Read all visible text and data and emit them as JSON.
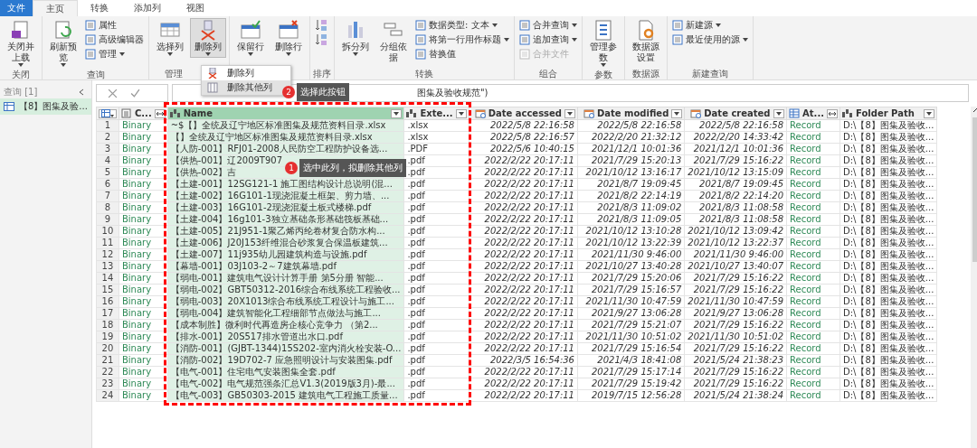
{
  "tabs": [
    {
      "label": "文件",
      "kind": "file",
      "selected": false
    },
    {
      "label": "主页",
      "kind": "tab",
      "selected": true
    },
    {
      "label": "转换",
      "kind": "tab",
      "selected": false
    },
    {
      "label": "添加列",
      "kind": "tab",
      "selected": false
    },
    {
      "label": "视图",
      "kind": "tab",
      "selected": false
    }
  ],
  "ribbon": [
    {
      "label": "关闭",
      "items": [
        {
          "kind": "large",
          "label": "关闭并上载",
          "dropdown": true,
          "pressed": false
        }
      ]
    },
    {
      "label": "查询",
      "items": [
        {
          "kind": "large",
          "label": "刷新预览",
          "dropdown": true,
          "pressed": false
        },
        {
          "kind": "stack",
          "buttons": [
            {
              "label": "属性",
              "dropdown": false,
              "disabled": false
            },
            {
              "label": "高级编辑器",
              "dropdown": false,
              "disabled": false
            },
            {
              "label": "管理",
              "dropdown": true,
              "disabled": false
            }
          ]
        }
      ]
    },
    {
      "label": "管理",
      "items": [
        {
          "kind": "large",
          "label": "选择列",
          "dropdown": true,
          "pressed": false
        },
        {
          "kind": "large",
          "label": "删除列",
          "dropdown": true,
          "pressed": true
        }
      ]
    },
    {
      "items": [
        {
          "kind": "large",
          "label": "保留行",
          "dropdown": true,
          "pressed": false
        },
        {
          "kind": "large",
          "label": "删除行",
          "dropdown": true,
          "pressed": false
        }
      ]
    },
    {
      "label": "排序",
      "items": [
        {
          "kind": "sort"
        }
      ]
    },
    {
      "label": "转换",
      "items": [
        {
          "kind": "large",
          "label": "拆分列",
          "dropdown": true,
          "pressed": false
        },
        {
          "kind": "large",
          "label": "分组依据",
          "dropdown": false,
          "pressed": false
        },
        {
          "kind": "stack",
          "buttons": [
            {
              "label": "数据类型: 文本",
              "dropdown": true,
              "disabled": false
            },
            {
              "label": "将第一行用作标题",
              "dropdown": true,
              "disabled": false
            },
            {
              "label": "替换值",
              "dropdown": false,
              "disabled": false
            }
          ]
        }
      ]
    },
    {
      "label": "组合",
      "items": [
        {
          "kind": "stack",
          "buttons": [
            {
              "label": "合并查询",
              "dropdown": true,
              "disabled": false
            },
            {
              "label": "追加查询",
              "dropdown": true,
              "disabled": false
            },
            {
              "label": "合并文件",
              "dropdown": false,
              "disabled": true
            }
          ]
        }
      ]
    },
    {
      "label": "参数",
      "items": [
        {
          "kind": "large",
          "label": "管理参数",
          "dropdown": true,
          "pressed": false
        }
      ]
    },
    {
      "label": "数据源",
      "items": [
        {
          "kind": "large",
          "label": "数据源设置",
          "dropdown": false,
          "pressed": false
        }
      ]
    },
    {
      "label": "新建查询",
      "items": [
        {
          "kind": "stack",
          "buttons": [
            {
              "label": "新建源",
              "dropdown": true,
              "disabled": false
            },
            {
              "label": "最近使用的源",
              "dropdown": true,
              "disabled": false
            }
          ]
        }
      ]
    }
  ],
  "menu": {
    "items": [
      {
        "label": "删除列",
        "selected": false
      },
      {
        "label": "删除其他列",
        "selected": true
      }
    ]
  },
  "callouts": [
    {
      "number": "2",
      "text": "选择此按钮"
    },
    {
      "number": "1",
      "text": "选中此列，拟删除其他列"
    }
  ],
  "highlight_frame": true,
  "queries_pane": {
    "title": "查询 [1]",
    "items": [
      {
        "label": "【8】图集及验...",
        "selected": true
      }
    ]
  },
  "formula_bar": {
    "formula": "图集及验收规范\")"
  },
  "table": {
    "columns": [
      {
        "label": "C...",
        "kind": "list",
        "selected": false
      },
      {
        "label": "Name",
        "kind": "text",
        "selected": true
      },
      {
        "label": "Exte...",
        "kind": "text",
        "selected": false
      },
      {
        "label": "Date accessed",
        "kind": "date",
        "selected": false
      },
      {
        "label": "Date modified",
        "kind": "date",
        "selected": false
      },
      {
        "label": "Date created",
        "kind": "date",
        "selected": false
      },
      {
        "label": "At...",
        "kind": "record",
        "selected": false
      },
      {
        "label": "Folder Path",
        "kind": "text",
        "selected": false
      }
    ],
    "rows": [
      {
        "number": "1",
        "cells": [
          "Binary",
          "~$【】全统及辽宁地区标准图集及规范资料目录.xlsx",
          ".xlsx",
          "2022/5/8 22:16:58",
          "2022/5/8 22:16:58",
          "2022/5/8 22:16:58",
          "Record",
          "D:\\【8】图集及验收..."
        ]
      },
      {
        "number": "2",
        "cells": [
          "Binary",
          "【】全统及辽宁地区标准图集及规范资料目录.xlsx",
          ".xlsx",
          "2022/5/8 22:16:57",
          "2022/2/20 21:32:12",
          "2022/2/20 14:33:42",
          "Record",
          "D:\\【8】图集及验收..."
        ]
      },
      {
        "number": "3",
        "cells": [
          "Binary",
          "【人防-001】RFJ01-2008人民防空工程防护设备选...",
          ".PDF",
          "2022/5/6 10:40:15",
          "2021/12/1 10:01:36",
          "2021/12/1 10:01:36",
          "Record",
          "D:\\【8】图集及验收..."
        ]
      },
      {
        "number": "4",
        "cells": [
          "Binary",
          "【供热-001】辽2009T907",
          ".pdf",
          "2022/2/22 20:17:11",
          "2021/7/29 15:20:13",
          "2021/7/29 15:16:22",
          "Record",
          "D:\\【8】图集及验收..."
        ]
      },
      {
        "number": "5",
        "cells": [
          "Binary",
          "【供热-002】吉",
          ".pdf",
          "2022/2/22 20:17:11",
          "2021/10/12 13:16:17",
          "2021/10/12 13:15:09",
          "Record",
          "D:\\【8】图集及验收..."
        ]
      },
      {
        "number": "6",
        "cells": [
          "Binary",
          "【土建-001】12SG121-1 施工图结构设计总说明(混...",
          ".pdf",
          "2022/2/22 20:17:11",
          "2021/8/7 19:09:45",
          "2021/8/7 19:09:45",
          "Record",
          "D:\\【8】图集及验收..."
        ]
      },
      {
        "number": "7",
        "cells": [
          "Binary",
          "【土建-002】16G101-1现浇混凝土框架、剪力墙、...",
          ".pdf",
          "2022/2/22 20:17:11",
          "2021/8/2 22:14:19",
          "2021/8/2 22:14:20",
          "Record",
          "D:\\【8】图集及验收..."
        ]
      },
      {
        "number": "8",
        "cells": [
          "Binary",
          "【土建-003】16G101-2现浇混凝土板式楼梯.pdf",
          ".pdf",
          "2022/2/22 20:17:11",
          "2021/8/3 11:09:02",
          "2021/8/3 11:08:58",
          "Record",
          "D:\\【8】图集及验收..."
        ]
      },
      {
        "number": "9",
        "cells": [
          "Binary",
          "【土建-004】16g101-3独立基础条形基础筏板基础...",
          ".pdf",
          "2022/2/22 20:17:11",
          "2021/8/3 11:09:05",
          "2021/8/3 11:08:58",
          "Record",
          "D:\\【8】图集及验收..."
        ]
      },
      {
        "number": "10",
        "cells": [
          "Binary",
          "【土建-005】21J951-1聚乙烯丙纶卷材复合防水构...",
          ".pdf",
          "2022/2/22 20:17:11",
          "2021/10/12 13:10:28",
          "2021/10/12 13:09:42",
          "Record",
          "D:\\【8】图集及验收..."
        ]
      },
      {
        "number": "11",
        "cells": [
          "Binary",
          "【土建-006】J20J153纤维混合砂浆复合保温板建筑...",
          ".pdf",
          "2022/2/22 20:17:11",
          "2021/10/12 13:22:39",
          "2021/10/12 13:22:37",
          "Record",
          "D:\\【8】图集及验收..."
        ]
      },
      {
        "number": "12",
        "cells": [
          "Binary",
          "【土建-007】11j935幼儿园建筑构造与设施.pdf",
          ".pdf",
          "2022/2/22 20:17:11",
          "2021/11/30 9:46:00",
          "2021/11/30 9:46:00",
          "Record",
          "D:\\【8】图集及验收..."
        ]
      },
      {
        "number": "13",
        "cells": [
          "Binary",
          "【幕墙-001】03J103-2～7建筑幕墙.pdf",
          ".pdf",
          "2022/2/22 20:17:11",
          "2021/10/27 13:40:28",
          "2021/10/27 13:40:07",
          "Record",
          "D:\\【8】图集及验收..."
        ]
      },
      {
        "number": "14",
        "cells": [
          "Binary",
          "【弱电-001】建筑电气设计计算手册 第5分册 智能...",
          ".pdf",
          "2022/2/22 20:17:11",
          "2021/7/29 15:20:06",
          "2021/7/29 15:16:22",
          "Record",
          "D:\\【8】图集及验收..."
        ]
      },
      {
        "number": "15",
        "cells": [
          "Binary",
          "【弱电-002】GBT50312-2016综合布线系统工程验收...",
          ".pdf",
          "2022/2/22 20:17:11",
          "2021/7/29 15:16:57",
          "2021/7/29 15:16:22",
          "Record",
          "D:\\【8】图集及验收..."
        ]
      },
      {
        "number": "16",
        "cells": [
          "Binary",
          "【弱电-003】20X1013综合布线系统工程设计与施工...",
          ".pdf",
          "2022/2/22 20:17:11",
          "2021/11/30 10:47:59",
          "2021/11/30 10:47:59",
          "Record",
          "D:\\【8】图集及验收..."
        ]
      },
      {
        "number": "17",
        "cells": [
          "Binary",
          "【弱电-004】建筑智能化工程细部节点做法与施工...",
          ".pdf",
          "2022/2/22 20:17:11",
          "2021/9/27 13:06:28",
          "2021/9/27 13:06:28",
          "Record",
          "D:\\【8】图集及验收..."
        ]
      },
      {
        "number": "18",
        "cells": [
          "Binary",
          "【成本制胜】微利时代再造房企核心竞争力 （第2...",
          ".pdf",
          "2022/2/22 20:17:11",
          "2021/7/29 15:21:07",
          "2021/7/29 15:16:22",
          "Record",
          "D:\\【8】图集及验收..."
        ]
      },
      {
        "number": "19",
        "cells": [
          "Binary",
          "【排水-001】20S517排水管道出水口.pdf",
          ".pdf",
          "2022/2/22 20:17:11",
          "2021/11/30 10:51:02",
          "2021/11/30 10:51:02",
          "Record",
          "D:\\【8】图集及验收..."
        ]
      },
      {
        "number": "20",
        "cells": [
          "Binary",
          "【消防-001】(GJBT-1344)15S202-室内消火栓安装-O...",
          ".pdf",
          "2022/2/22 20:17:11",
          "2021/7/29 15:16:54",
          "2021/7/29 15:16:22",
          "Record",
          "D:\\【8】图集及验收..."
        ]
      },
      {
        "number": "21",
        "cells": [
          "Binary",
          "【消防-002】19D702-7 应急照明设计与安装图集.pdf",
          ".pdf",
          "2022/3/5 16:54:36",
          "2021/4/3 18:41:08",
          "2021/5/24 21:38:23",
          "Record",
          "D:\\【8】图集及验收..."
        ]
      },
      {
        "number": "22",
        "cells": [
          "Binary",
          "【电气-001】住宅电气安装图集全套.pdf",
          ".pdf",
          "2022/2/22 20:17:11",
          "2021/7/29 15:17:14",
          "2021/7/29 15:16:22",
          "Record",
          "D:\\【8】图集及验收..."
        ]
      },
      {
        "number": "23",
        "cells": [
          "Binary",
          "【电气-002】电气规范强条汇总V1.3(2019版3月)-最...",
          ".pdf",
          "2022/2/22 20:17:11",
          "2021/7/29 15:19:42",
          "2021/7/29 15:16:22",
          "Record",
          "D:\\【8】图集及验收..."
        ]
      },
      {
        "number": "24",
        "cells": [
          "Binary",
          "【电气-003】GB50303-2015 建筑电气工程施工质量...",
          ".pdf",
          "2022/2/22 20:17:11",
          "2019/7/15 12:56:28",
          "2021/5/24 21:38:24",
          "Record",
          "D:\\【8】图集及验收..."
        ]
      }
    ]
  }
}
